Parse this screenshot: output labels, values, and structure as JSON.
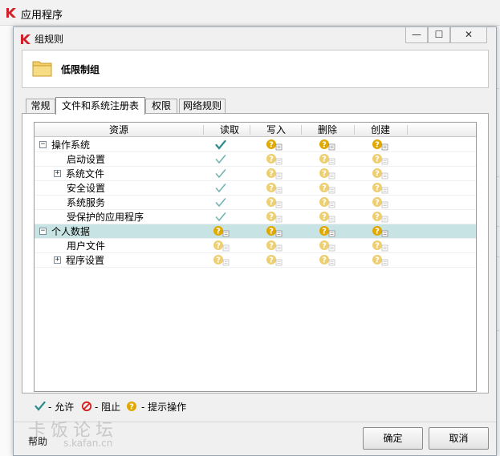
{
  "outer_window": {
    "title": "应用程序"
  },
  "dialog": {
    "title": "组规则",
    "window_buttons": {
      "minimize": "—",
      "maximize": "☐",
      "close": "✕"
    },
    "group_name": "低限制组"
  },
  "tabs": [
    {
      "label": "常规"
    },
    {
      "label": "文件和系统注册表",
      "active": true
    },
    {
      "label": "权限"
    },
    {
      "label": "网络规则"
    }
  ],
  "table": {
    "columns": [
      "资源",
      "读取",
      "写入",
      "删除",
      "创建"
    ],
    "rows": [
      {
        "label": "操作系统",
        "level": 0,
        "expander": "−",
        "read": "allow",
        "write": "prompt",
        "delete": "prompt",
        "create": "prompt",
        "inherited": false
      },
      {
        "label": "启动设置",
        "level": 1,
        "expander": "",
        "read": "allow",
        "write": "prompt",
        "delete": "prompt",
        "create": "prompt",
        "inherited": true
      },
      {
        "label": "系统文件",
        "level": 1,
        "expander": "+",
        "read": "allow",
        "write": "prompt",
        "delete": "prompt",
        "create": "prompt",
        "inherited": true
      },
      {
        "label": "安全设置",
        "level": 1,
        "expander": "",
        "read": "allow",
        "write": "prompt",
        "delete": "prompt",
        "create": "prompt",
        "inherited": true
      },
      {
        "label": "系统服务",
        "level": 1,
        "expander": "",
        "read": "allow",
        "write": "prompt",
        "delete": "prompt",
        "create": "prompt",
        "inherited": true
      },
      {
        "label": "受保护的应用程序",
        "level": 1,
        "expander": "",
        "read": "allow",
        "write": "prompt",
        "delete": "prompt",
        "create": "prompt",
        "inherited": true
      },
      {
        "label": "个人数据",
        "level": 0,
        "expander": "−",
        "read": "prompt",
        "write": "prompt",
        "delete": "prompt",
        "create": "prompt",
        "inherited": false,
        "selected": true
      },
      {
        "label": "用户文件",
        "level": 1,
        "expander": "",
        "read": "prompt",
        "write": "prompt",
        "delete": "prompt",
        "create": "prompt",
        "inherited": true
      },
      {
        "label": "程序设置",
        "level": 1,
        "expander": "+",
        "read": "prompt",
        "write": "prompt",
        "delete": "prompt",
        "create": "prompt",
        "inherited": true
      }
    ]
  },
  "legend": {
    "allow": "- 允许",
    "block": "- 阻止",
    "prompt": "- 提示操作"
  },
  "footer": {
    "help": "帮助",
    "ok": "确定",
    "cancel": "取消"
  },
  "watermark": {
    "text": "卡饭论坛",
    "url": "s.kafan.cn"
  },
  "colors": {
    "allow_check": "#2e8b8b",
    "prompt_badge": "#e0a800",
    "block_icon": "#d62020",
    "selected_row": "#c8e3e3",
    "logo_red": "#d0202a"
  }
}
